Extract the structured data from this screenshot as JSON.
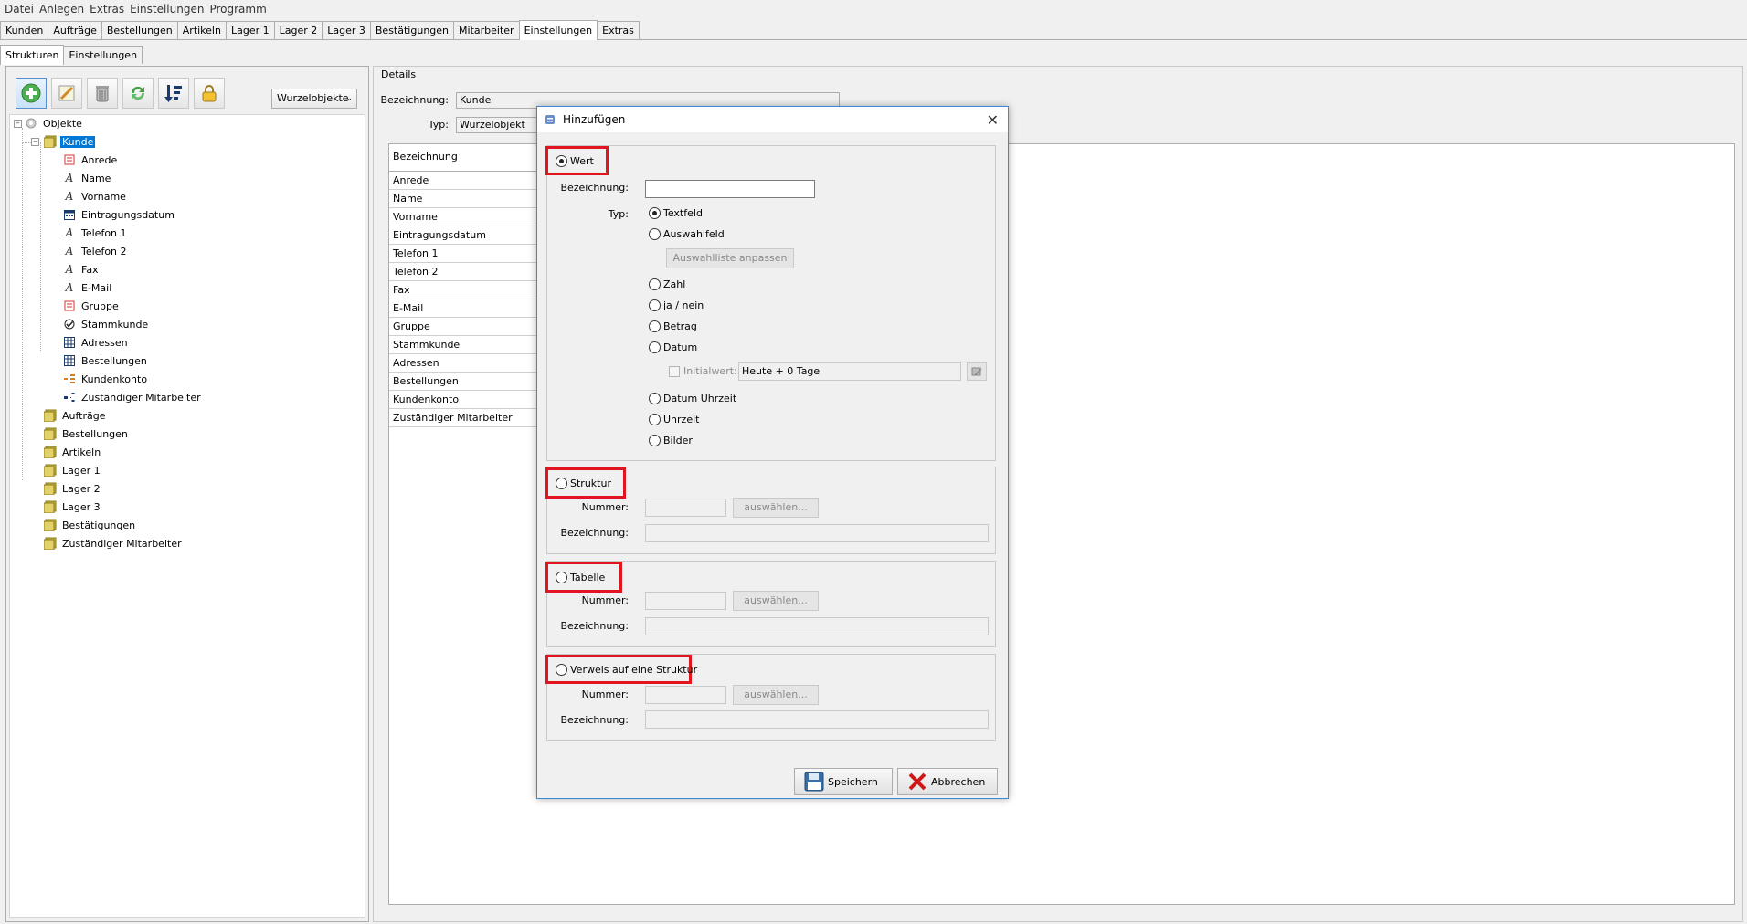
{
  "menu": [
    "Datei",
    "Anlegen",
    "Extras",
    "Einstellungen",
    "Programm"
  ],
  "top_tabs": [
    "Kunden",
    "Aufträge",
    "Bestellungen",
    "Artikeln",
    "Lager 1",
    "Lager 2",
    "Lager 3",
    "Bestätigungen",
    "Mitarbeiter",
    "Einstellungen",
    "Extras"
  ],
  "top_tabs_active": "Einstellungen",
  "sub_tabs": [
    "Strukturen",
    "Einstellungen"
  ],
  "sub_tabs_active": "Strukturen",
  "toolbar": {
    "icons": [
      "add-icon",
      "edit-icon",
      "delete-icon",
      "refresh-icon",
      "sort-icon",
      "lock-icon"
    ],
    "combo_value": "Wurzelobjekte"
  },
  "tree": {
    "root": "Objekte",
    "selected": "Kunde",
    "kunde_children": [
      "Anrede",
      "Name",
      "Vorname",
      "Eintragungsdatum",
      "Telefon 1",
      "Telefon 2",
      "Fax",
      "E-Mail",
      "Gruppe",
      "Stammkunde",
      "Adressen",
      "Bestellungen",
      "Kundenkonto",
      "Zuständiger Mitarbeiter"
    ],
    "kunde_children_icons": [
      "list-icon",
      "text-icon",
      "text-icon",
      "calendar-icon",
      "text-icon",
      "text-icon",
      "text-icon",
      "text-icon",
      "list-icon",
      "check-icon",
      "table-icon",
      "table-icon",
      "structure-icon",
      "reference-icon"
    ],
    "top_level": [
      "Kunde",
      "Aufträge",
      "Bestellungen",
      "Artikeln",
      "Lager 1",
      "Lager 2",
      "Lager 3",
      "Bestätigungen",
      "Zuständiger Mitarbeiter"
    ]
  },
  "details": {
    "title": "Details",
    "bezeichnung_label": "Bezeichnung:",
    "bezeichnung_value": "Kunde",
    "typ_label": "Typ:",
    "typ_value": "Wurzelobjekt",
    "table_header": "Bezeichnung",
    "rows": [
      "Anrede",
      "Name",
      "Vorname",
      "Eintragungsdatum",
      "Telefon 1",
      "Telefon 2",
      "Fax",
      "E-Mail",
      "Gruppe",
      "Stammkunde",
      "Adressen",
      "Bestellungen",
      "Kundenkonto",
      "Zuständiger Mitarbeiter"
    ]
  },
  "dialog": {
    "title": "Hinzufügen",
    "wert": {
      "label": "Wert",
      "selected": true,
      "bezeichnung_label": "Bezeichnung:",
      "bezeichnung_value": "",
      "typ_label": "Typ:",
      "types": [
        "Textfeld",
        "Auswahlfeld",
        "Zahl",
        "ja / nein",
        "Betrag",
        "Datum",
        "Datum Uhrzeit",
        "Uhrzeit",
        "Bilder"
      ],
      "selected_type": "Textfeld",
      "auswahlliste_button": "Auswahlliste anpassen",
      "initialwert_label": "Initialwert:",
      "initialwert_value": "Heute + 0 Tage"
    },
    "struktur": {
      "label": "Struktur",
      "nummer_label": "Nummer:",
      "select_button": "auswählen...",
      "bezeichnung_label": "Bezeichnung:"
    },
    "tabelle": {
      "label": "Tabelle",
      "nummer_label": "Nummer:",
      "select_button": "auswählen...",
      "bezeichnung_label": "Bezeichnung:"
    },
    "verweis": {
      "label": "Verweis auf eine Struktur",
      "nummer_label": "Nummer:",
      "select_button": "auswählen...",
      "bezeichnung_label": "Bezeichnung:"
    },
    "save_button": "Speichern",
    "cancel_button": "Abbrechen"
  },
  "colors": {
    "selection": "#0078d7",
    "highlight_frame": "#e0151f",
    "dialog_border": "#3c8ad6"
  }
}
